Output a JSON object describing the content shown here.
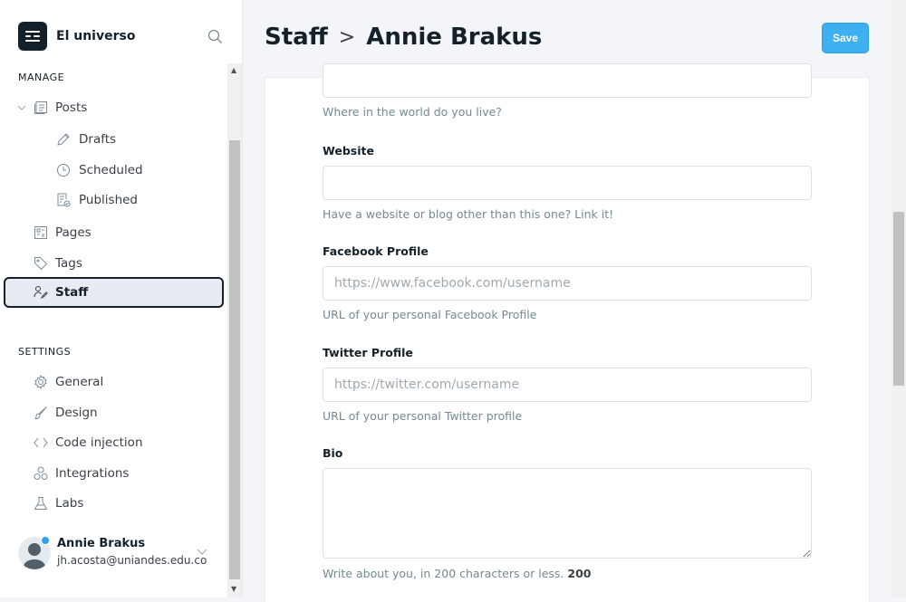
{
  "brand": {
    "name": "El universo"
  },
  "sidebar": {
    "manage_label": "MANAGE",
    "settings_label": "SETTINGS",
    "items": [
      {
        "label": "Posts",
        "icon": "posts-icon"
      },
      {
        "label": "Drafts",
        "icon": "pencil-icon"
      },
      {
        "label": "Scheduled",
        "icon": "clock-icon"
      },
      {
        "label": "Published",
        "icon": "published-icon"
      },
      {
        "label": "Pages",
        "icon": "pages-icon"
      },
      {
        "label": "Tags",
        "icon": "tag-icon"
      },
      {
        "label": "Staff",
        "icon": "staff-icon",
        "active": true
      }
    ],
    "settings": [
      {
        "label": "General",
        "icon": "gear-icon"
      },
      {
        "label": "Design",
        "icon": "brush-icon"
      },
      {
        "label": "Code injection",
        "icon": "code-icon"
      },
      {
        "label": "Integrations",
        "icon": "integrations-icon"
      },
      {
        "label": "Labs",
        "icon": "flask-icon"
      }
    ],
    "user": {
      "name": "Annie Brakus",
      "email": "jh.acosta@uniandes.edu.co"
    }
  },
  "header": {
    "breadcrumb_parent": "Staff",
    "separator": ">",
    "title": "Annie Brakus",
    "save_label": "Save"
  },
  "colors": {
    "accent": "#3eb0ef",
    "dark": "#15212a"
  },
  "form": {
    "location_hint": "Where in the world do you live?",
    "website": {
      "label": "Website",
      "value": "",
      "hint": "Have a website or blog other than this one? Link it!"
    },
    "facebook": {
      "label": "Facebook Profile",
      "placeholder": "https://www.facebook.com/username",
      "hint": "URL of your personal Facebook Profile"
    },
    "twitter": {
      "label": "Twitter Profile",
      "placeholder": "https://twitter.com/username",
      "hint": "URL of your personal Twitter profile"
    },
    "bio": {
      "label": "Bio",
      "hint": "Write about you, in 200 characters or less.",
      "count": "200"
    }
  }
}
